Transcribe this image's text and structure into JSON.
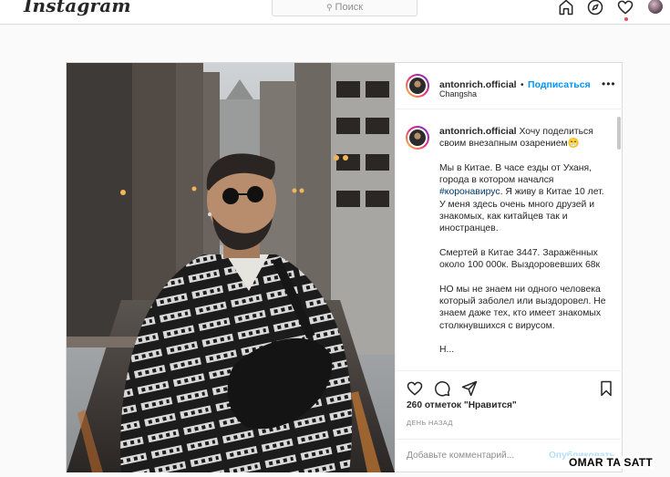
{
  "nav": {
    "logo": "Instagram",
    "search_placeholder": "Поиск",
    "icons": [
      "home-icon",
      "explore-compass-icon",
      "activity-heart-icon",
      "profile-avatar"
    ]
  },
  "post": {
    "username": "antonrich.official",
    "separator": "•",
    "follow_label": "Подписаться",
    "location": "Changsha",
    "more_label": "•••",
    "caption_intro": "Хочу поделиться своим внезапным озарением😁",
    "caption_p1_before": "Мы в Китае. В часе езды от Уханя, города в котором начался ",
    "caption_hashtag": "#коронавирус",
    "caption_p1_after": ". Я живу в Китае 10 лет. У меня здесь очень много друзей и знакомых, как китайцев так и иностранцев.",
    "caption_p2": "Смертей в Китае 3447. Заражённых около 100 000к. Выздоровевших 68к",
    "caption_p3": "НО мы не знаем ни одного человека который заболел или выздоровел. Не знаем даже тех, кто имеет знакомых столкнувшихся с вирусом.",
    "caption_p4": "Н...",
    "likes": "260 отметок \"Нравится\"",
    "date": "ДЕНЬ НАЗАД",
    "comment_placeholder": "Добавьте комментарий...",
    "publish_label": "Опубликовать"
  },
  "watermark": "OMAR TA SATT",
  "colors": {
    "accent": "#0095f6",
    "hashtag": "#00376b",
    "border": "#dbdbdb",
    "notification": "#ed4956"
  }
}
